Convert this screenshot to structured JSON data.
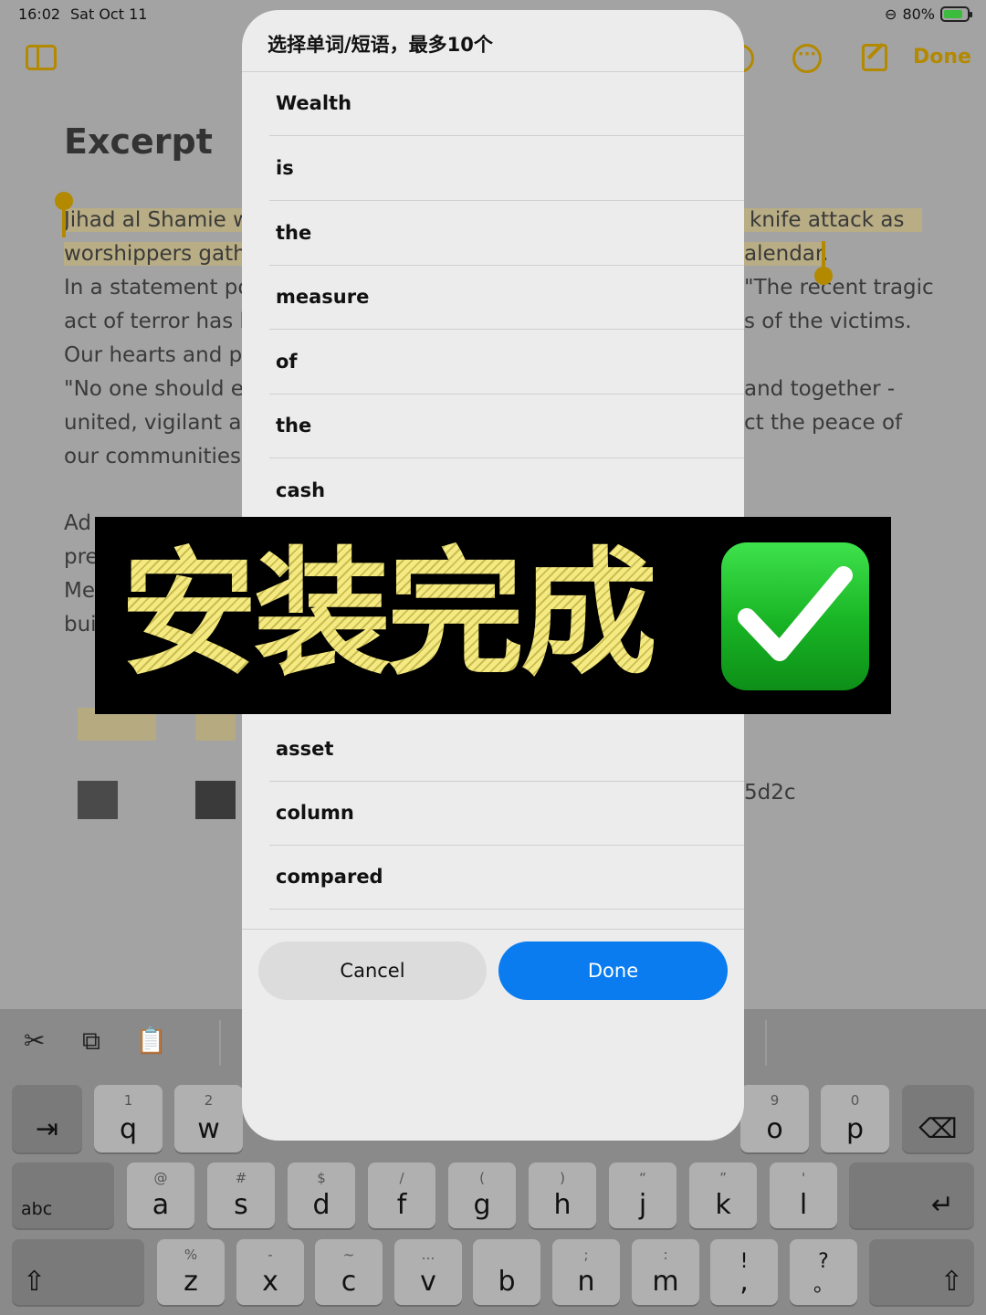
{
  "status_bar": {
    "time": "16:02",
    "date": "Sat Oct 11",
    "battery": "80%"
  },
  "toolbar": {
    "done_label": "Done",
    "more_glyph": "···"
  },
  "note": {
    "title": "Excerpt",
    "left_lines": [
      "Jihad al Shamie w",
      "worshippers gathe",
      "In a statement pos",
      "act of terror has b",
      "Our hearts and pr",
      "\"No one should ev",
      "united, vigilant an",
      "our communities.\""
    ],
    "right_lines": [
      "knife attack as",
      "alendar.",
      "\"The recent tragic",
      "s of the victims.",
      "and together -",
      "ct the peace of"
    ],
    "para2_left": [
      "Ad",
      "pre",
      "Me",
      "bui"
    ],
    "hash_fragment": "5d2c"
  },
  "modal": {
    "title": "选择单词/短语，最多10个",
    "words": [
      "Wealth",
      "is",
      "the",
      "measure",
      "of",
      "the",
      "cash",
      "asset",
      "column",
      "compared"
    ],
    "cancel_label": "Cancel",
    "done_label": "Done"
  },
  "banner": {
    "text": "安装完成",
    "check_icon": "check-mark-button-emoji"
  },
  "keyboard": {
    "shortcuts": [
      "scissors-icon",
      "copy-icon",
      "paste-icon"
    ],
    "row1": [
      {
        "sub": "1",
        "main": "q"
      },
      {
        "sub": "2",
        "main": "w"
      },
      {
        "sub": "9",
        "main": "o"
      },
      {
        "sub": "0",
        "main": "p"
      }
    ],
    "row2": [
      {
        "sub": "@",
        "main": "a"
      },
      {
        "sub": "#",
        "main": "s"
      },
      {
        "sub": "$",
        "main": "d"
      },
      {
        "sub": "/",
        "main": "f"
      },
      {
        "sub": "(",
        "main": "g"
      },
      {
        "sub": ")",
        "main": "h"
      },
      {
        "sub": "“",
        "main": "j"
      },
      {
        "sub": "”",
        "main": "k"
      },
      {
        "sub": "'",
        "main": "l"
      }
    ],
    "row3": [
      {
        "sub": "%",
        "main": "z"
      },
      {
        "sub": "-",
        "main": "x"
      },
      {
        "sub": "~",
        "main": "c"
      },
      {
        "sub": "…",
        "main": "v"
      },
      {
        "sub": "",
        "main": "b"
      },
      {
        "sub": ";",
        "main": "n"
      },
      {
        "sub": ":",
        "main": "m"
      },
      {
        "sub": "!",
        "main": ","
      },
      {
        "sub": "?",
        "main": "。"
      }
    ],
    "abc_label": "abc"
  }
}
